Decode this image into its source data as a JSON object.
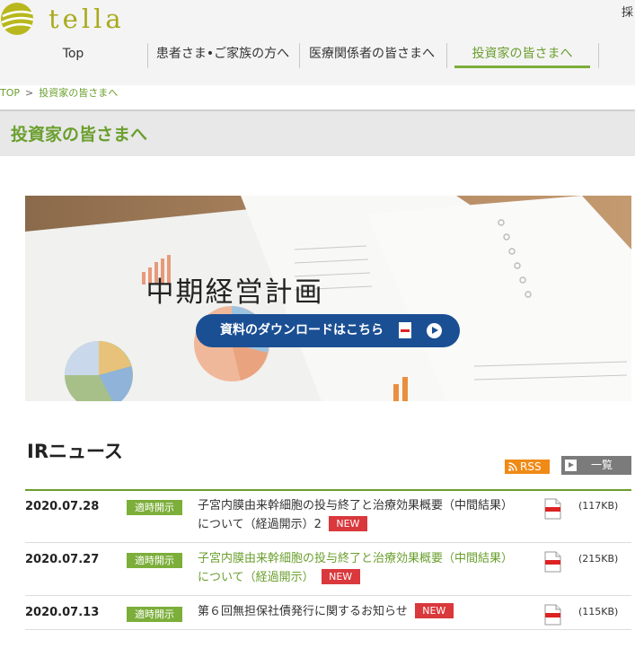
{
  "header": {
    "logo_text": "tella",
    "top_right_text": "採",
    "nav": [
      {
        "label": "Top"
      },
      {
        "label": "患者さま•ご家族の方へ"
      },
      {
        "label": "医療関係者の皆さまへ"
      },
      {
        "label": "投資家の皆さまへ"
      }
    ]
  },
  "breadcrumb": {
    "home": "TOP",
    "separator": ">",
    "current": "投資家の皆さまへ"
  },
  "page_title": "投資家の皆さまへ",
  "hero": {
    "heading": "中期経営計画",
    "button_label": "資料のダウンロードはこちら"
  },
  "ir_news": {
    "title": "IRニュース",
    "rss_label": "RSS",
    "list_label": "一覧",
    "new_label": "NEW",
    "items": [
      {
        "date": "2020.07.28",
        "tag": "適時開示",
        "text": "子宮内膜由来幹細胞の投与終了と治療効果概要（中間結果）について（経過開示）2",
        "size": "(117KB)"
      },
      {
        "date": "2020.07.27",
        "tag": "適時開示",
        "text": "子宮内膜由来幹細胞の投与終了と治療効果概要（中間結果）について（経過開示）",
        "size": "(215KB)"
      },
      {
        "date": "2020.07.13",
        "tag": "適時開示",
        "text": "第６回無担保社債発行に関するお知らせ",
        "size": "(115KB)"
      }
    ]
  },
  "colors": {
    "brand_green": "#6b9f2e",
    "logo_olive": "#a8aa1b",
    "button_blue": "#1b4f93",
    "new_red": "#d9383c",
    "rss_orange": "#f08a16"
  }
}
